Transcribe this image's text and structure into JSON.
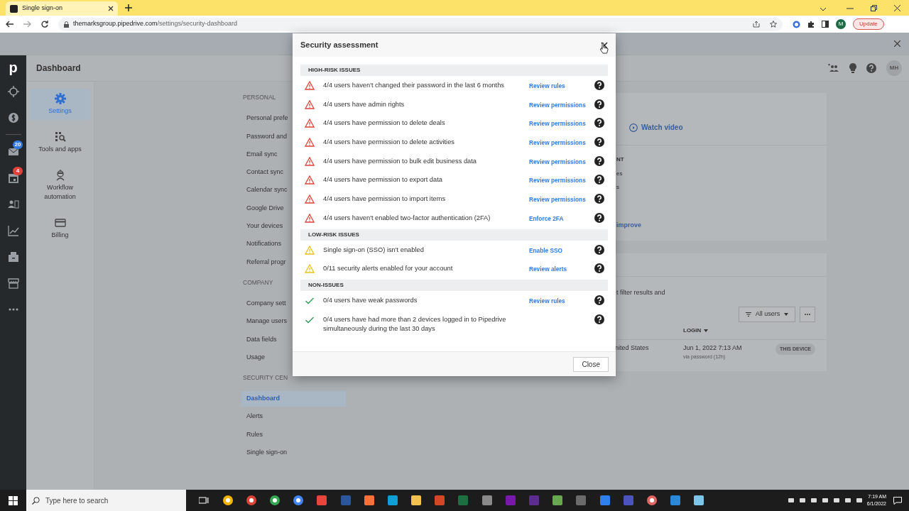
{
  "browser": {
    "tab_title": "Single sign-on",
    "url_host": "themarksgroup.pipedrive.com",
    "url_path": "/settings/security-dashboard",
    "update_button": "Update",
    "profile_initial": "M"
  },
  "app": {
    "logo": "p",
    "rail_badges": [
      {
        "kind": "mail",
        "badge": "20",
        "color": "#317ae2"
      },
      {
        "kind": "calendar",
        "badge": "4",
        "color": "#e0433b"
      }
    ],
    "page_title": "Dashboard",
    "user_initials": "MH",
    "settings_nav": [
      {
        "kind": "gear",
        "label": "Settings",
        "selected": true
      },
      {
        "kind": "tools",
        "label": "Tools and apps",
        "selected": false
      },
      {
        "kind": "robot",
        "label": "Workflow automation",
        "selected": false
      },
      {
        "kind": "card",
        "label": "Billing",
        "selected": false
      }
    ],
    "menu": [
      {
        "heading": "PERSONAL",
        "items": [
          {
            "label": "Personal prefe",
            "selected": false
          },
          {
            "label": "Password and",
            "selected": false
          },
          {
            "label": "Email sync",
            "selected": false
          },
          {
            "label": "Contact sync",
            "selected": false
          },
          {
            "label": "Calendar sync",
            "selected": false
          },
          {
            "label": "Google Drive",
            "selected": false
          },
          {
            "label": "Your devices",
            "selected": false
          },
          {
            "label": "Notifications",
            "selected": false
          },
          {
            "label": "Referral progr",
            "selected": false
          }
        ]
      },
      {
        "heading": "COMPANY",
        "items": [
          {
            "label": "Company sett",
            "selected": false
          },
          {
            "label": "Manage users",
            "selected": false
          },
          {
            "label": "Data fields",
            "selected": false
          },
          {
            "label": "Usage",
            "selected": false
          }
        ]
      },
      {
        "heading": "SECURITY CEN",
        "items": [
          {
            "label": "Dashboard",
            "selected": true
          },
          {
            "label": "Alerts",
            "selected": false
          },
          {
            "label": "Rules",
            "selected": false
          },
          {
            "label": "Single sign-on",
            "selected": false
          }
        ]
      }
    ],
    "content": {
      "watch_video": "Watch video",
      "section_fragment": "NT",
      "list_fragments": [
        "es",
        "s"
      ],
      "link_fragment": "improve",
      "description_fragment": "t filter results and",
      "filter_button": "All users",
      "column_login": "LOGIN",
      "session": {
        "location_fragment": "nited States",
        "login_time": "Jun 1, 2022 7:13 AM",
        "login_method": "via password (12h)",
        "badge": "THIS DEVICE"
      }
    }
  },
  "modal": {
    "title": "Security assessment",
    "sections": [
      {
        "heading": "HIGH-RISK ISSUES",
        "items": [
          {
            "kind": "high",
            "text": "4/4 users haven't changed their password in the last 6 months",
            "action": "Review rules"
          },
          {
            "kind": "high",
            "text": "4/4 users have admin rights",
            "action": "Review permissions"
          },
          {
            "kind": "high",
            "text": "4/4 users have permission to delete deals",
            "action": "Review permissions"
          },
          {
            "kind": "high",
            "text": "4/4 users have permission to delete activities",
            "action": "Review permissions"
          },
          {
            "kind": "high",
            "text": "4/4 users have permission to bulk edit business data",
            "action": "Review permissions"
          },
          {
            "kind": "high",
            "text": "4/4 users have permission to export data",
            "action": "Review permissions"
          },
          {
            "kind": "high",
            "text": "4/4 users have permission to import items",
            "action": "Review permissions"
          },
          {
            "kind": "high",
            "text": "4/4 users haven't enabled two-factor authentication (2FA)",
            "action": "Enforce 2FA"
          }
        ]
      },
      {
        "heading": "LOW-RISK ISSUES",
        "items": [
          {
            "kind": "low",
            "text": "Single sign-on (SSO) isn't enabled",
            "action": "Enable SSO"
          },
          {
            "kind": "low",
            "text": "0/11 security alerts enabled for your account",
            "action": "Review alerts"
          }
        ]
      },
      {
        "heading": "NON-ISSUES",
        "items": [
          {
            "kind": "ok",
            "text": "0/4 users have weak passwords",
            "action": "Review rules"
          },
          {
            "kind": "ok",
            "text": "0/4 users have had more than 2 devices logged in to Pipedrive simultaneously during the last 30 days"
          }
        ]
      }
    ],
    "close_button": "Close"
  },
  "taskbar": {
    "search_placeholder": "Type here to search",
    "time": "7:19 AM",
    "date": "6/1/2022"
  }
}
